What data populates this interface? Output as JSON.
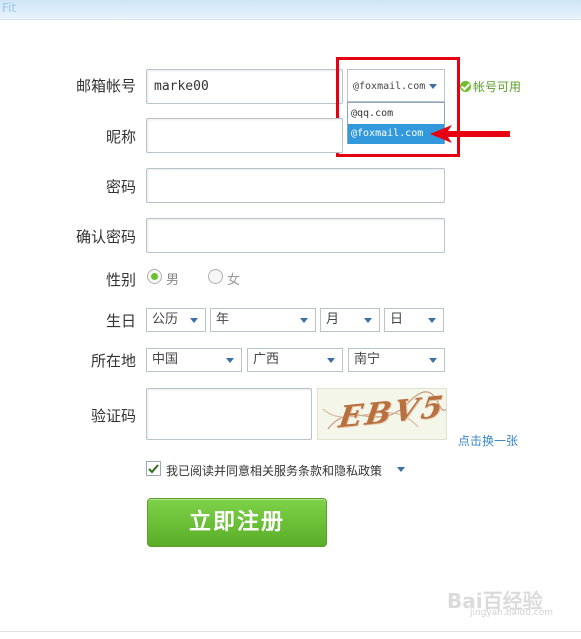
{
  "topbar": {
    "glyph": "Fit"
  },
  "form": {
    "email": {
      "label": "邮箱帐号",
      "value": "marke00",
      "domain_selected": "@foxmail.com",
      "domain_options": [
        "@qq.com",
        "@foxmail.com"
      ],
      "available_text": "帐号可用"
    },
    "nickname": {
      "label": "昵称",
      "value": ""
    },
    "password": {
      "label": "密码",
      "value": ""
    },
    "confirm_password": {
      "label": "确认密码",
      "value": ""
    },
    "gender": {
      "label": "性别",
      "male": "男",
      "female": "女",
      "selected": "男"
    },
    "birthday": {
      "label": "生日",
      "calendar": "公历",
      "year": "年",
      "month": "月",
      "day": "日"
    },
    "location": {
      "label": "所在地",
      "country": "中国",
      "province": "广西",
      "city": "南宁"
    },
    "captcha": {
      "label": "验证码",
      "value": "",
      "image_text": "EBV5",
      "refresh_link": "点击换一张"
    },
    "agreement": {
      "text": "我已阅读并同意相关服务条款和隐私政策",
      "checked": true
    },
    "submit_label": "立即注册"
  },
  "watermark": {
    "brand": "Bai百经验",
    "url": "jingyan.baidu.com"
  },
  "colors": {
    "accent_green": "#6cbf2c",
    "highlight_blue": "#3399dd",
    "annotation_red": "#e60012"
  }
}
